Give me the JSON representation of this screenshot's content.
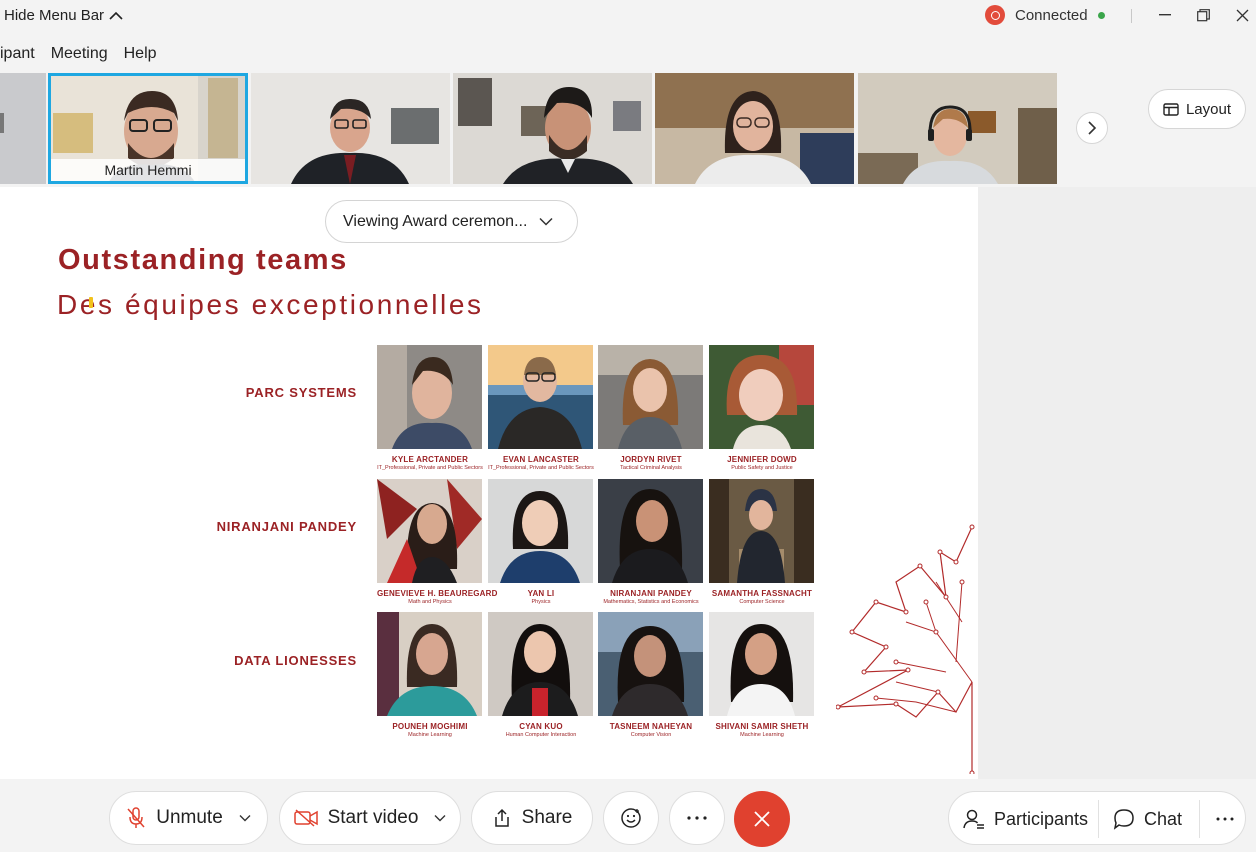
{
  "titlebar": {
    "hide_menu_label": "Hide Menu Bar",
    "connection_status": "Connected",
    "colors": {
      "record": "#e24b3b",
      "connected": "#3aa54a"
    }
  },
  "menu": {
    "items": [
      "ipant",
      "Meeting",
      "Help"
    ]
  },
  "participants_strip": {
    "active_name": "Martin Hemmi",
    "layout_label": "Layout"
  },
  "share_view": {
    "viewing_label": "Viewing Award ceremon..."
  },
  "slide": {
    "title": "Outstanding teams",
    "subtitle": "Des équipes exceptionnelles",
    "accent_color": "#9b2225",
    "teams": [
      {
        "name": "PARC SYSTEMS",
        "members": [
          {
            "name": "KYLE ARCTANDER",
            "dept": "IT_Professional, Private and Public Sectors"
          },
          {
            "name": "EVAN LANCASTER",
            "dept": "IT_Professional, Private and Public Sectors"
          },
          {
            "name": "JORDYN RIVET",
            "dept": "Tactical Criminal Analysis"
          },
          {
            "name": "JENNIFER DOWD",
            "dept": "Public Safety and Justice"
          }
        ]
      },
      {
        "name": "NIRANJANI PANDEY",
        "members": [
          {
            "name": "GENEVIEVE H. BEAUREGARD",
            "dept": "Math and Physics"
          },
          {
            "name": "YAN LI",
            "dept": "Physics"
          },
          {
            "name": "NIRANJANI PANDEY",
            "dept": "Mathematics, Statistics and Economics"
          },
          {
            "name": "SAMANTHA FASSNACHT",
            "dept": "Computer Science"
          }
        ]
      },
      {
        "name": "DATA LIONESSES",
        "members": [
          {
            "name": "POUNEH MOGHIMI",
            "dept": "Machine Learning"
          },
          {
            "name": "CYAN KUO",
            "dept": "Human Computer Interaction"
          },
          {
            "name": "TASNEEM NAHEYAN",
            "dept": "Computer Vision"
          },
          {
            "name": "SHIVANI SAMIR SHETH",
            "dept": "Machine Learning"
          }
        ]
      }
    ]
  },
  "controls": {
    "unmute_label": "Unmute",
    "start_video_label": "Start video",
    "share_label": "Share",
    "participants_label": "Participants",
    "chat_label": "Chat",
    "leave_color": "#e0412f"
  }
}
